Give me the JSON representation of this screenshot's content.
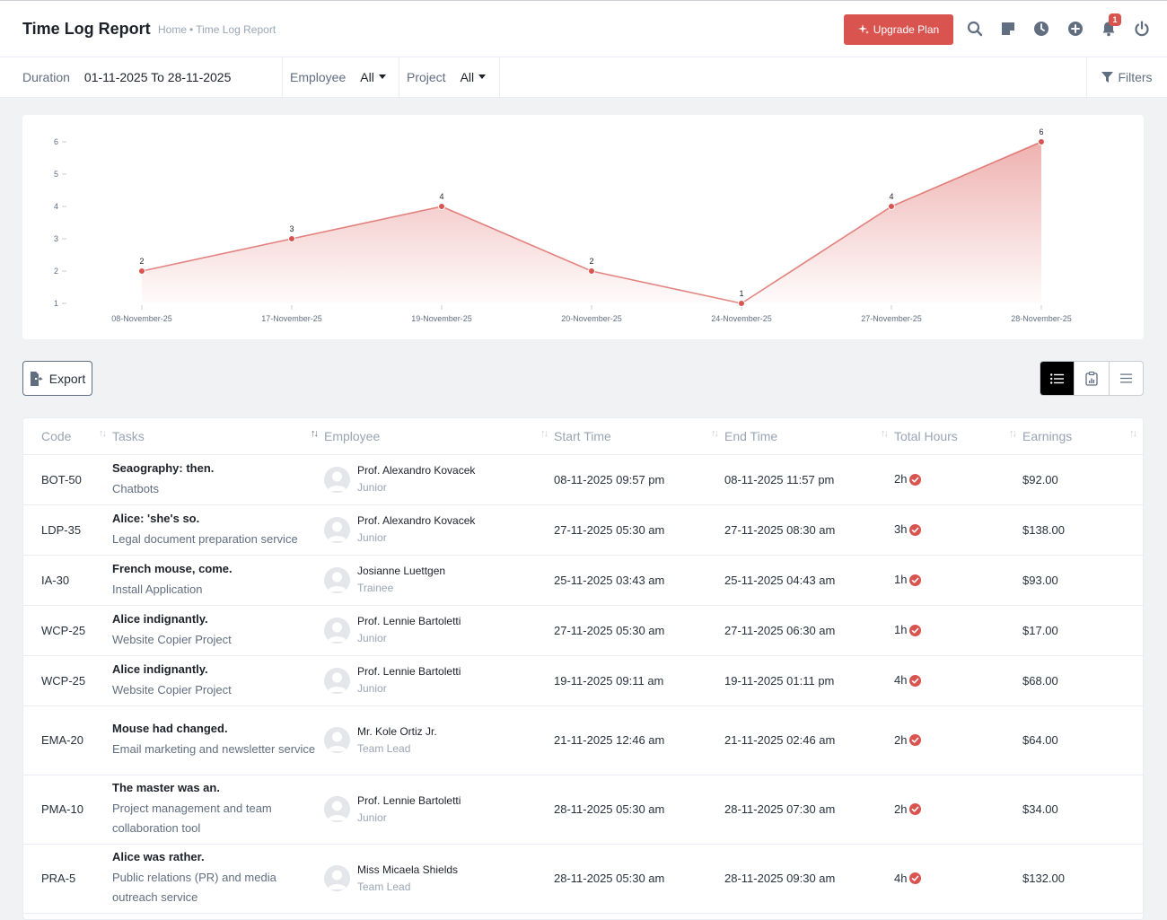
{
  "header": {
    "title": "Time Log Report",
    "breadcrumb": [
      "Home",
      "Time Log Report"
    ],
    "breadcrumb_sep": "•",
    "upgrade_label": "Upgrade Plan",
    "notification_count": "1",
    "accent": "#d9534f"
  },
  "filters": {
    "duration_label": "Duration",
    "duration_value": "01-11-2025 To 28-11-2025",
    "employee_label": "Employee",
    "employee_value": "All",
    "project_label": "Project",
    "project_value": "All",
    "filters_label": "Filters"
  },
  "chart_data": {
    "type": "area",
    "categories": [
      "08-November-25",
      "17-November-25",
      "19-November-25",
      "20-November-25",
      "24-November-25",
      "27-November-25",
      "28-November-25"
    ],
    "values": [
      2,
      3,
      4,
      2,
      1,
      4,
      6
    ],
    "yticks": [
      1,
      2,
      3,
      4,
      5,
      6
    ],
    "ylim": [
      1,
      6
    ],
    "color": "#d9534f",
    "grid": false,
    "data_labels": true
  },
  "toolbar": {
    "export_label": "Export"
  },
  "table": {
    "columns": [
      "Code",
      "Tasks",
      "Employee",
      "Start Time",
      "End Time",
      "Total Hours",
      "Earnings"
    ],
    "rows": [
      {
        "code": "BOT-50",
        "task": "Seaography: then.",
        "project": "Chatbots",
        "employee": "Prof. Alexandro Kovacek",
        "role": "Junior",
        "start": "08-11-2025 09:57 pm",
        "end": "08-11-2025 11:57 pm",
        "hours": "2h",
        "earnings": "$92.00"
      },
      {
        "code": "LDP-35",
        "task": "Alice: 'she's so.",
        "project": "Legal document preparation service",
        "employee": "Prof. Alexandro Kovacek",
        "role": "Junior",
        "start": "27-11-2025 05:30 am",
        "end": "27-11-2025 08:30 am",
        "hours": "3h",
        "earnings": "$138.00"
      },
      {
        "code": "IA-30",
        "task": "French mouse, come.",
        "project": "Install Application",
        "employee": "Josianne Luettgen",
        "role": "Trainee",
        "start": "25-11-2025 03:43 am",
        "end": "25-11-2025 04:43 am",
        "hours": "1h",
        "earnings": "$93.00"
      },
      {
        "code": "WCP-25",
        "task": "Alice indignantly.",
        "project": "Website Copier Project",
        "employee": "Prof. Lennie Bartoletti",
        "role": "Junior",
        "start": "27-11-2025 05:30 am",
        "end": "27-11-2025 06:30 am",
        "hours": "1h",
        "earnings": "$17.00"
      },
      {
        "code": "WCP-25",
        "task": "Alice indignantly.",
        "project": "Website Copier Project",
        "employee": "Prof. Lennie Bartoletti",
        "role": "Junior",
        "start": "19-11-2025 09:11 am",
        "end": "19-11-2025 01:11 pm",
        "hours": "4h",
        "earnings": "$68.00"
      },
      {
        "code": "EMA-20",
        "task": "Mouse had changed.",
        "project": "Email marketing and newsletter service",
        "employee": "Mr. Kole Ortiz Jr.",
        "role": "Team Lead",
        "start": "21-11-2025 12:46 am",
        "end": "21-11-2025 02:46 am",
        "hours": "2h",
        "earnings": "$64.00"
      },
      {
        "code": "PMA-10",
        "task": "The master was an.",
        "project": "Project management and team collaboration tool",
        "employee": "Prof. Lennie Bartoletti",
        "role": "Junior",
        "start": "28-11-2025 05:30 am",
        "end": "28-11-2025 07:30 am",
        "hours": "2h",
        "earnings": "$34.00"
      },
      {
        "code": "PRA-5",
        "task": "Alice was rather.",
        "project": "Public relations (PR) and media outreach service",
        "employee": "Miss Micaela Shields",
        "role": "Team Lead",
        "start": "28-11-2025 05:30 am",
        "end": "28-11-2025 09:30 am",
        "hours": "4h",
        "earnings": "$132.00"
      }
    ]
  }
}
